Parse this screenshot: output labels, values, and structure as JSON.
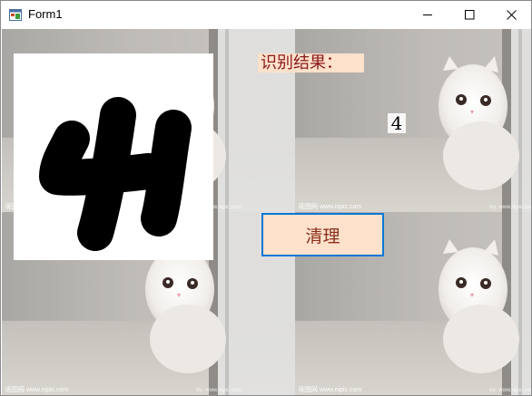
{
  "window": {
    "title": "Form1"
  },
  "caption_icons": [
    "form-app-icon",
    "minimize-icon",
    "maximize-icon",
    "close-icon"
  ],
  "form": {
    "result_label": "识别结果：",
    "result_value": "4",
    "clear_button_label": "清理"
  },
  "background": {
    "tile_image": "white-kitten-photo",
    "watermark": "昵图网 www.nipic.com"
  }
}
